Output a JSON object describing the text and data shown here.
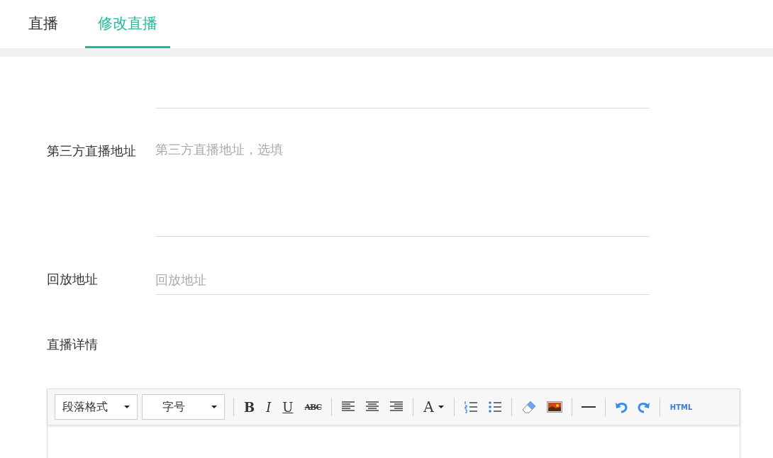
{
  "tabs": [
    {
      "label": "直播",
      "selected": false
    },
    {
      "label": "修改直播",
      "selected": true
    }
  ],
  "form": [
    {
      "kind": "textarea",
      "label": "第三方直播地址",
      "placeholder": "第三方直播地址，选填"
    },
    {
      "kind": "input",
      "label": "回放地址",
      "placeholder": "回放地址"
    },
    {
      "kind": "heading",
      "label": "直播详情"
    }
  ],
  "toolbar": [
    {
      "kind": "select",
      "text": "段落格式"
    },
    {
      "kind": "select",
      "text": "字号"
    },
    {
      "kind": "separator"
    },
    {
      "kind": "bold",
      "text": "B"
    },
    {
      "kind": "italic",
      "text": "I"
    },
    {
      "kind": "underline",
      "text": "U"
    },
    {
      "kind": "strike",
      "text": "ABC"
    },
    {
      "kind": "separator"
    },
    {
      "kind": "alignleft"
    },
    {
      "kind": "aligncenter"
    },
    {
      "kind": "alignright"
    },
    {
      "kind": "separator"
    },
    {
      "kind": "fontcolor",
      "text": "A"
    },
    {
      "kind": "separator"
    },
    {
      "kind": "orderedlist"
    },
    {
      "kind": "bulletlist"
    },
    {
      "kind": "separator"
    },
    {
      "kind": "eraser"
    },
    {
      "kind": "image"
    },
    {
      "kind": "separator"
    },
    {
      "kind": "rule"
    },
    {
      "kind": "separator"
    },
    {
      "kind": "undo"
    },
    {
      "kind": "redo"
    },
    {
      "kind": "separator"
    },
    {
      "kind": "html",
      "text": "HTML"
    }
  ]
}
